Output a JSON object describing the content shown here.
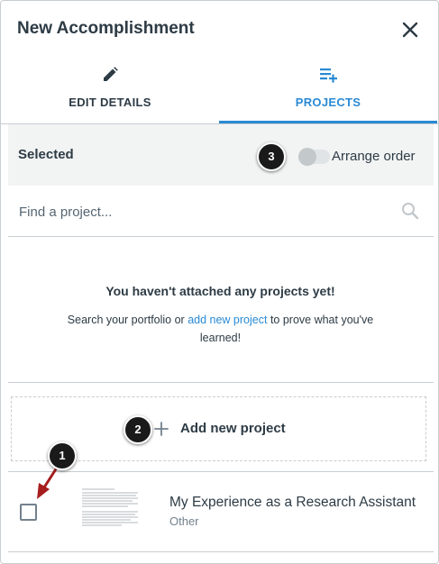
{
  "header": {
    "title": "New Accomplishment",
    "close_icon": "close-icon"
  },
  "tabs": [
    {
      "label": "EDIT DETAILS",
      "icon": "pencil-icon",
      "active": false
    },
    {
      "label": "PROJECTS",
      "icon": "playlist-add-icon",
      "active": true
    }
  ],
  "selected_bar": {
    "label": "Selected",
    "toggle_label": "Arrange order",
    "toggle_on": false
  },
  "search": {
    "placeholder": "Find a project...",
    "value": "",
    "icon": "search-icon"
  },
  "empty_state": {
    "title": "You haven't attached any projects yet!",
    "desc_before": "Search your portfolio or ",
    "desc_link": "add new project",
    "desc_after": " to prove what you've learned!"
  },
  "add_project": {
    "label": "Add new project",
    "icon": "plus-icon"
  },
  "projects": [
    {
      "title": "My Experience as a Research Assistant",
      "subtitle": "Other",
      "checked": false
    }
  ],
  "callouts": [
    "1",
    "2",
    "3"
  ],
  "colors": {
    "accent": "#2a8ad4",
    "text": "#2d3b45",
    "muted": "#73818c",
    "border": "#c7cdd1",
    "panel": "#f2f4f4",
    "annotation_arrow": "#a61d1d"
  }
}
